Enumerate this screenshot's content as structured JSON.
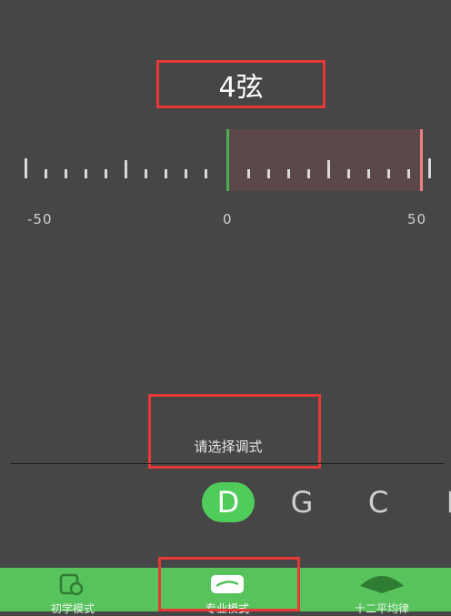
{
  "tuner": {
    "string_label": "4弦",
    "scale_labels": {
      "min": "-50",
      "center": "0",
      "max": "50"
    },
    "indicator_cents": 50
  },
  "tuning": {
    "prompt": "请选择调式",
    "notes": [
      "D",
      "G",
      "C",
      "F"
    ],
    "selected_note": "D"
  },
  "bottom_nav": {
    "items": [
      {
        "label": "初学模式",
        "icon": "beginner-mode-icon"
      },
      {
        "label": "专业模式",
        "icon": "pro-mode-icon",
        "active": true
      },
      {
        "label": "十二平均律",
        "icon": "equal-temperament-icon"
      }
    ]
  },
  "colors": {
    "background": "#464646",
    "accent_green": "#4fcc59",
    "nav_green": "#58c35c",
    "limit_red": "#f08080",
    "highlight_red": "#e53935"
  }
}
